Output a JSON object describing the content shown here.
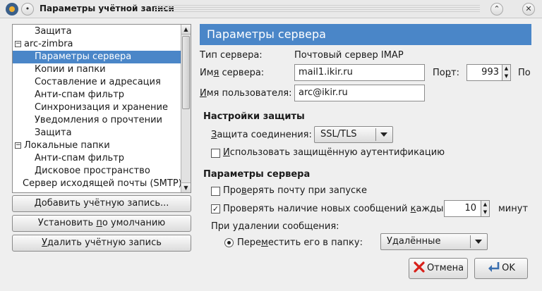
{
  "window": {
    "title": "Параметры учётной записи",
    "app_icon": "thunderbird-icon",
    "minimize_glyph": "⌃",
    "close_glyph": "✕",
    "menu_glyph": "•"
  },
  "tree": {
    "items": [
      {
        "label": "Защита",
        "level": 2,
        "selected": false
      },
      {
        "label": "arc-zimbra",
        "level": 1,
        "expander": "−",
        "selected": false
      },
      {
        "label": "Параметры сервера",
        "level": 2,
        "selected": true
      },
      {
        "label": "Копии и папки",
        "level": 2,
        "selected": false
      },
      {
        "label": "Составление и адресация",
        "level": 2,
        "selected": false
      },
      {
        "label": "Анти-спам фильтр",
        "level": 2,
        "selected": false
      },
      {
        "label": "Синхронизация и хранение",
        "level": 2,
        "selected": false
      },
      {
        "label": "Уведомления о прочтении",
        "level": 2,
        "selected": false
      },
      {
        "label": "Защита",
        "level": 2,
        "selected": false
      },
      {
        "label": "Локальные папки",
        "level": 1,
        "expander": "−",
        "selected": false
      },
      {
        "label": "Анти-спам фильтр",
        "level": 2,
        "selected": false
      },
      {
        "label": "Дисковое пространство",
        "level": 2,
        "selected": false
      },
      {
        "label": "Сервер исходящей почты (SMTP)",
        "level": 0,
        "selected": false
      }
    ]
  },
  "left_buttons": {
    "add_account": {
      "pre": "",
      "u": "Д",
      "post": "обавить учётную запись..."
    },
    "set_default": {
      "pre": "Установить ",
      "u": "п",
      "post": "о умолчанию"
    },
    "remove_account": {
      "pre": "",
      "u": "У",
      "post": "далить учётную запись"
    }
  },
  "panel": {
    "header": "Параметры сервера",
    "server_type_label": "Тип сервера:",
    "server_type_value": "Почтовый сервер IMAP",
    "server_name_label": {
      "pre": "Им",
      "u": "я",
      "post": " сервера:"
    },
    "server_name_value": "mail1.ikir.ru",
    "port_label": {
      "pre": "По",
      "u": "р",
      "post": "т:"
    },
    "port_value": "993",
    "port_trailing": "По",
    "username_label": {
      "pre": "",
      "u": "И",
      "post": "мя пользователя:"
    },
    "username_value": "arc@ikir.ru"
  },
  "security": {
    "heading": "Настройки защиты",
    "connection_label": {
      "pre": "",
      "u": "З",
      "post": "ащита соединения:"
    },
    "connection_value": "SSL/TLS",
    "secure_auth": {
      "checked": false,
      "pre": "",
      "u": "И",
      "post": "спользовать защищённую аутентификацию"
    }
  },
  "server_settings": {
    "heading": "Параметры сервера",
    "check_on_startup": {
      "checked": false,
      "pre": "Про",
      "u": "в",
      "post": "ерять почту при запуске"
    },
    "check_every": {
      "checked": true,
      "pre": "Проверять наличие новых сообщений ",
      "u": "к",
      "post": "аждые"
    },
    "interval_value": "10",
    "interval_unit": "минут",
    "on_delete_label": "При удалении сообщения:",
    "move_to_folder": {
      "selected": true,
      "pre": "Пере",
      "u": "м",
      "post": "естить его в папку:"
    },
    "folder_value": "Удалённые"
  },
  "dialog_buttons": {
    "cancel": "Отмена",
    "ok": "OK"
  },
  "colors": {
    "accent": "#4a86c8",
    "cancel_icon": "#d8201a",
    "ok_icon": "#3a6fb0"
  }
}
